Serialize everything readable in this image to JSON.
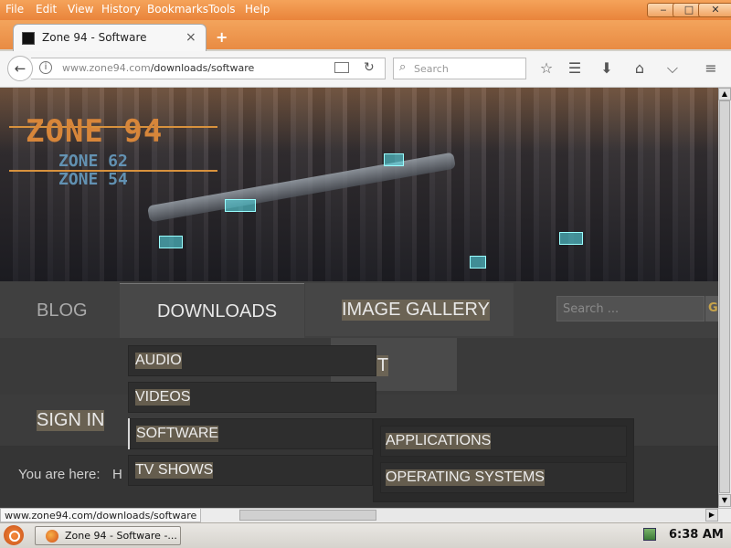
{
  "menubar": {
    "items": [
      "File",
      "Edit",
      "View",
      "History",
      "Bookmarks",
      "Tools",
      "Help"
    ],
    "window_buttons": [
      "minimize",
      "maximize",
      "close"
    ]
  },
  "tab": {
    "title": "Zone 94 - Software",
    "close_glyph": "×",
    "new_tab_glyph": "+"
  },
  "navbar": {
    "url_host": "www.zone94.com",
    "url_path": "/downloads/software",
    "search_placeholder": "Search",
    "icons": [
      "back-icon",
      "info-icon",
      "reader-view-icon",
      "reload-icon",
      "search-icon",
      "bookmark-star-icon",
      "reading-list-icon",
      "download-icon",
      "home-icon",
      "pocket-icon",
      "hamburger-menu-icon"
    ]
  },
  "site": {
    "logo": {
      "main": "ZONE 94",
      "sub1": "ZONE 62",
      "sub2": "ZONE 54"
    },
    "nav": {
      "blog": "BLOG",
      "downloads": "DOWNLOADS",
      "gallery": "IMAGE GALLERY",
      "checkit": "CK IT",
      "signin": "SIGN IN"
    },
    "search_placeholder": "Search ...",
    "search_button": "G",
    "breadcrumb_label": "You are here:",
    "breadcrumb_first": "H",
    "dropdown": [
      "AUDIO",
      "VIDEOS",
      "SOFTWARE",
      "TV SHOWS"
    ],
    "submenu": [
      "APPLICATIONS",
      "OPERATING SYSTEMS"
    ],
    "accent_color": "#d7863a"
  },
  "statusbar": {
    "link_url": "www.zone94.com/downloads/software"
  },
  "taskbar": {
    "task_label": "Zone 94 - Software -...",
    "clock": "6:38 AM"
  }
}
